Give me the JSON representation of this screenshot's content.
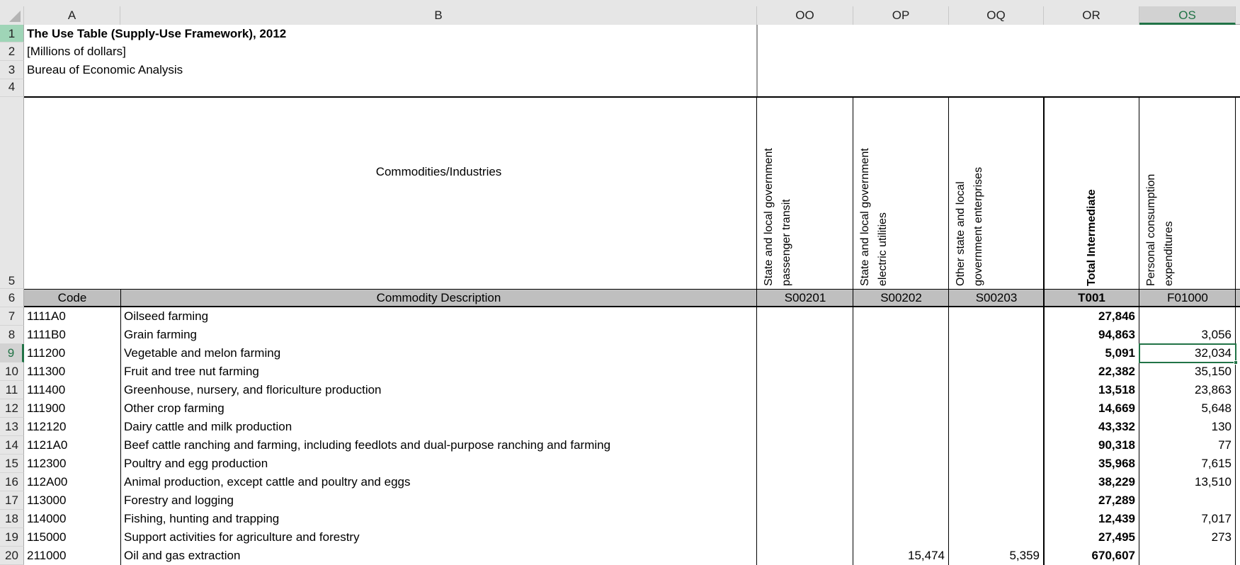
{
  "sheet": {
    "column_headers": [
      "A",
      "B",
      "OO",
      "OP",
      "OQ",
      "OR",
      "OS"
    ],
    "selected_column": "OS",
    "row_numbers": [
      "1",
      "2",
      "3",
      "4",
      "5",
      "6",
      "7",
      "8",
      "9",
      "10",
      "11",
      "12",
      "13",
      "14",
      "15",
      "16",
      "17",
      "18",
      "19",
      "20"
    ],
    "selected_row": "9",
    "selected_cell": "OS9"
  },
  "title": {
    "line1": "The Use Table (Supply-Use Framework), 2012",
    "line2": "[Millions of dollars]",
    "line3": "Bureau of Economic Analysis"
  },
  "header": {
    "corner_label": "Commodities/Industries",
    "industries": [
      {
        "name": "State and local government passenger transit",
        "line1": "State and local government",
        "line2": "passenger transit",
        "code": "S00201",
        "bold": false
      },
      {
        "name": "State and local government electric utilities",
        "line1": "State and local government",
        "line2": "electric utilities",
        "code": "S00202",
        "bold": false
      },
      {
        "name": "Other state and local government enterprises",
        "line1": "Other state and local",
        "line2": "government enterprises",
        "code": "S00203",
        "bold": false
      },
      {
        "name": "Total Intermediate",
        "line1": "Total Intermediate",
        "line2": "",
        "code": "T001",
        "bold": true
      },
      {
        "name": "Personal consumption expenditures",
        "line1": "Personal consumption",
        "line2": "expenditures",
        "code": "F01000",
        "bold": false
      }
    ],
    "code_label": "Code",
    "description_label": "Commodity Description"
  },
  "rows": [
    {
      "row": "7",
      "code": "1111A0",
      "description": "Oilseed farming",
      "S00201": "",
      "S00202": "",
      "S00203": "",
      "T001": "27,846",
      "F01000": ""
    },
    {
      "row": "8",
      "code": "1111B0",
      "description": "Grain farming",
      "S00201": "",
      "S00202": "",
      "S00203": "",
      "T001": "94,863",
      "F01000": "3,056"
    },
    {
      "row": "9",
      "code": "111200",
      "description": "Vegetable and melon farming",
      "S00201": "",
      "S00202": "",
      "S00203": "",
      "T001": "5,091",
      "F01000": "32,034"
    },
    {
      "row": "10",
      "code": "111300",
      "description": "Fruit and tree nut farming",
      "S00201": "",
      "S00202": "",
      "S00203": "",
      "T001": "22,382",
      "F01000": "35,150"
    },
    {
      "row": "11",
      "code": "111400",
      "description": "Greenhouse, nursery, and floriculture production",
      "S00201": "",
      "S00202": "",
      "S00203": "",
      "T001": "13,518",
      "F01000": "23,863"
    },
    {
      "row": "12",
      "code": "111900",
      "description": "Other crop farming",
      "S00201": "",
      "S00202": "",
      "S00203": "",
      "T001": "14,669",
      "F01000": "5,648"
    },
    {
      "row": "13",
      "code": "112120",
      "description": "Dairy cattle and milk production",
      "S00201": "",
      "S00202": "",
      "S00203": "",
      "T001": "43,332",
      "F01000": "130"
    },
    {
      "row": "14",
      "code": "1121A0",
      "description": "Beef cattle ranching and farming, including feedlots and dual-purpose ranching and farming",
      "S00201": "",
      "S00202": "",
      "S00203": "",
      "T001": "90,318",
      "F01000": "77"
    },
    {
      "row": "15",
      "code": "112300",
      "description": "Poultry and egg production",
      "S00201": "",
      "S00202": "",
      "S00203": "",
      "T001": "35,968",
      "F01000": "7,615"
    },
    {
      "row": "16",
      "code": "112A00",
      "description": "Animal production, except cattle and poultry and eggs",
      "S00201": "",
      "S00202": "",
      "S00203": "",
      "T001": "38,229",
      "F01000": "13,510"
    },
    {
      "row": "17",
      "code": "113000",
      "description": "Forestry and logging",
      "S00201": "",
      "S00202": "",
      "S00203": "",
      "T001": "27,289",
      "F01000": ""
    },
    {
      "row": "18",
      "code": "114000",
      "description": "Fishing, hunting and trapping",
      "S00201": "",
      "S00202": "",
      "S00203": "",
      "T001": "12,439",
      "F01000": "7,017"
    },
    {
      "row": "19",
      "code": "115000",
      "description": "Support activities for agriculture and forestry",
      "S00201": "",
      "S00202": "",
      "S00203": "",
      "T001": "27,495",
      "F01000": "273"
    },
    {
      "row": "20",
      "code": "211000",
      "description": "Oil and gas extraction",
      "S00201": "",
      "S00202": "15,474",
      "S00203": "5,359",
      "T001": "670,607",
      "F01000": ""
    }
  ],
  "colors": {
    "accent_green": "#217346",
    "header_grey": "#e6e6e6",
    "band_grey": "#bfbfbf"
  }
}
